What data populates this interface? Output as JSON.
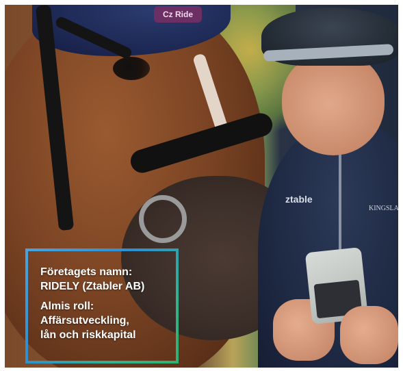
{
  "photo": {
    "bonnet_label": "Cz Ride",
    "jacket_logo": "ztable",
    "jacket_brand": "KINGSLA"
  },
  "info": {
    "company_label": "Företagets namn:",
    "company_value": "RIDELY (Ztabler AB)",
    "role_label": "Almis roll:",
    "role_line1": "Affärsutveckling,",
    "role_line2": "lån och riskkapital"
  },
  "colors": {
    "frame_gradient_start": "#4aa3dc",
    "frame_gradient_end": "#2fb36f",
    "text": "#ffffff"
  }
}
